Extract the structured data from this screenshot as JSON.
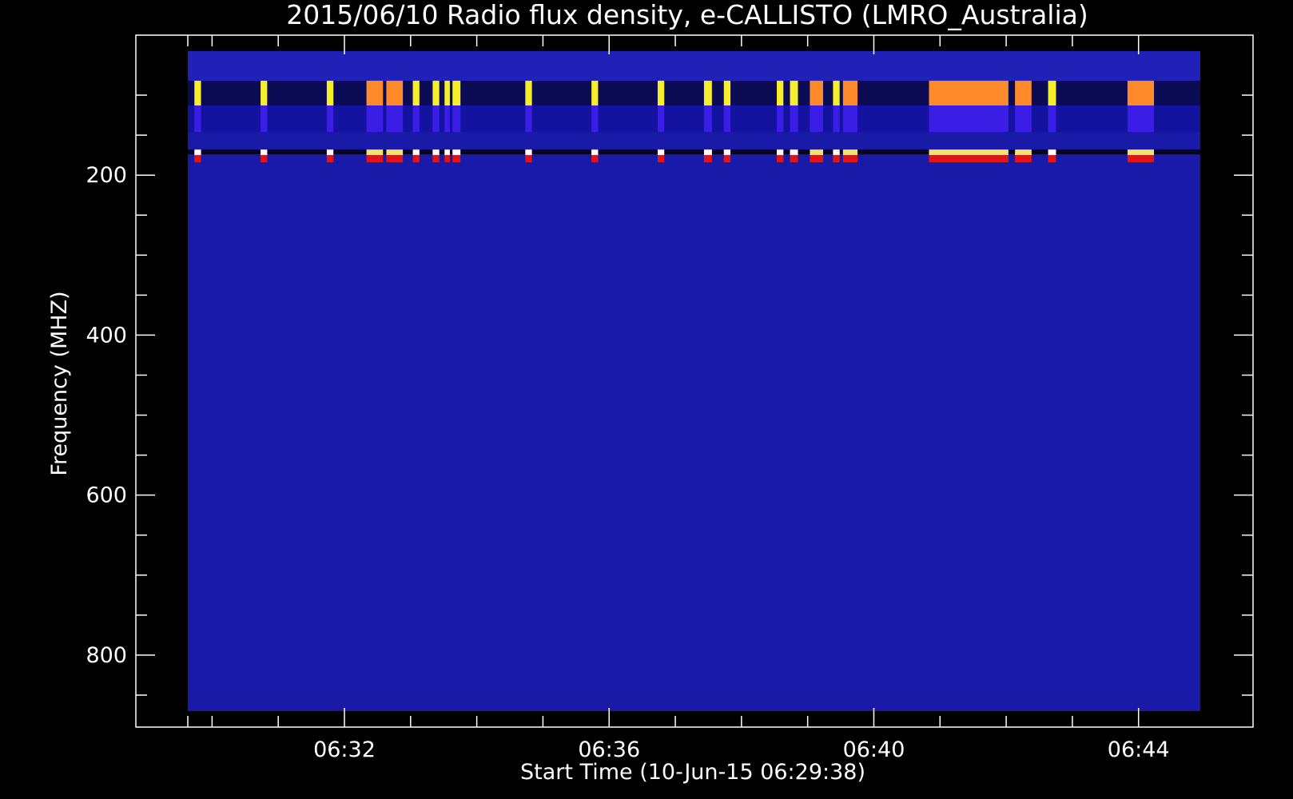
{
  "chart_data": {
    "type": "heatmap",
    "title": "2015/06/10  Radio flux density, e-CALLISTO (LMRO_Australia)",
    "xlabel": "Start Time (10-Jun-15 06:29:38)",
    "ylabel": "Frequency (MHZ)",
    "x_tick_labels": [
      "06:32",
      "06:36",
      "06:40",
      "06:44"
    ],
    "x_tick_minutes": [
      2.3667,
      6.3667,
      10.3667,
      14.3667
    ],
    "x_range_minutes": [
      0,
      15.3
    ],
    "y_tick_labels": [
      "200",
      "400",
      "600",
      "800"
    ],
    "y_ticks": [
      200,
      400,
      600,
      800
    ],
    "y_range": [
      45,
      870
    ],
    "y_inverted": true,
    "background_color": "#1a1aa8",
    "border_color": "#ffffff",
    "interference_bands_mhz": [
      [
        82,
        113
      ],
      [
        113,
        146
      ],
      [
        168,
        184
      ]
    ],
    "bursts_minutes": [
      [
        0.1,
        0.2
      ],
      [
        1.1,
        1.2
      ],
      [
        2.1,
        2.2
      ],
      [
        2.7,
        2.95
      ],
      [
        3.0,
        3.25
      ],
      [
        3.4,
        3.5
      ],
      [
        3.7,
        3.8
      ],
      [
        3.88,
        3.96
      ],
      [
        4.0,
        4.12
      ],
      [
        5.1,
        5.2
      ],
      [
        6.1,
        6.2
      ],
      [
        7.1,
        7.2
      ],
      [
        7.8,
        7.92
      ],
      [
        8.1,
        8.2
      ],
      [
        8.9,
        9.0
      ],
      [
        9.1,
        9.22
      ],
      [
        9.4,
        9.6
      ],
      [
        9.75,
        9.85
      ],
      [
        9.9,
        10.12
      ],
      [
        11.2,
        12.4
      ],
      [
        12.5,
        12.75
      ],
      [
        13.0,
        13.12
      ],
      [
        14.2,
        14.6
      ]
    ],
    "grid": false
  }
}
